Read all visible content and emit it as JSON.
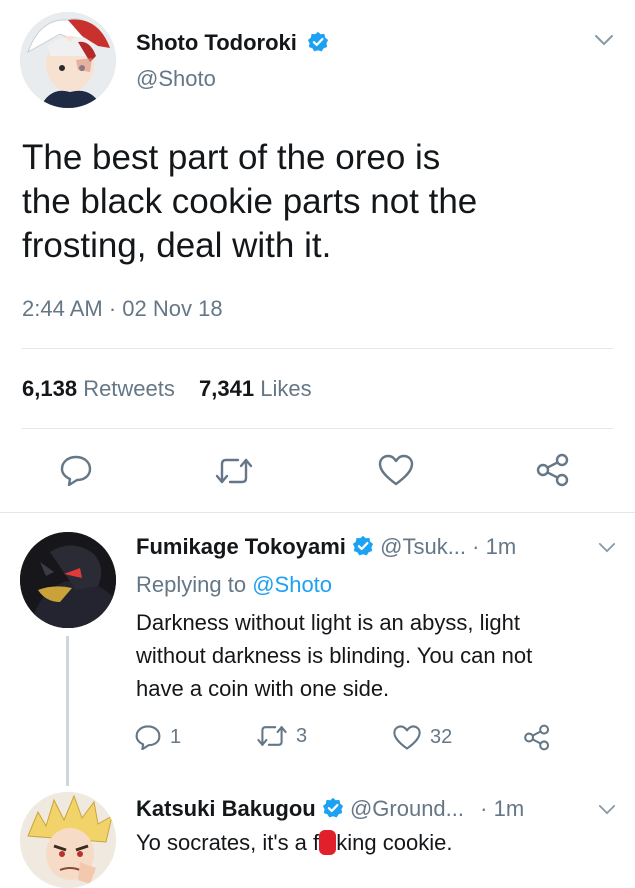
{
  "main_tweet": {
    "display_name": "Shoto Todoroki",
    "handle": "@Shoto",
    "text_line1": "The best part of the oreo is",
    "text_line2": "the black cookie parts not the",
    "text_line3": "frosting, deal with it.",
    "time": "2:44 AM",
    "separator": "·",
    "date": "02 Nov 18",
    "retweets_count": "6,138",
    "retweets_label": "Retweets",
    "likes_count": "7,341",
    "likes_label": "Likes"
  },
  "reply1": {
    "display_name": "Fumikage Tokoyami",
    "handle": "@Tsuk...",
    "time": "· 1m",
    "replying_label": "Replying to",
    "replying_handle": "@Shoto",
    "text_line1": "Darkness without light is an abyss, light",
    "text_line2": "without darkness is blinding. You can not",
    "text_line3": "have a coin with one side.",
    "reply_count": "1",
    "retweet_count": "3",
    "like_count": "32"
  },
  "reply2": {
    "display_name": "Katsuki Bakugou",
    "handle": "@Ground...",
    "time": "· 1m",
    "text_before": "Yo socrates, it's a f",
    "text_censored": "**",
    "text_after": "king cookie."
  },
  "colors": {
    "accent": "#1da1f2",
    "secondary_text": "#657786",
    "divider": "#e1e8ed",
    "censor": "#e0202a"
  }
}
